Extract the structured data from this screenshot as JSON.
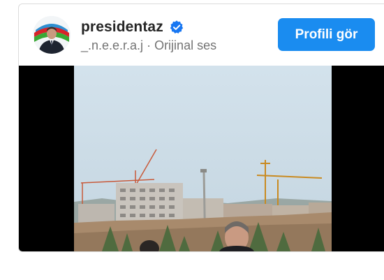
{
  "post": {
    "username": "presidentaz",
    "verified_icon": "verified-badge-icon",
    "audio_author": "_.n.e.e.r.a.j",
    "separator": " · ",
    "audio_label": "Orijinal ses",
    "profile_button": "Profili gör"
  },
  "colors": {
    "button": "#1a8cf0",
    "verified": "#1877f2",
    "username": "#262626",
    "secondary_text": "#737373"
  }
}
